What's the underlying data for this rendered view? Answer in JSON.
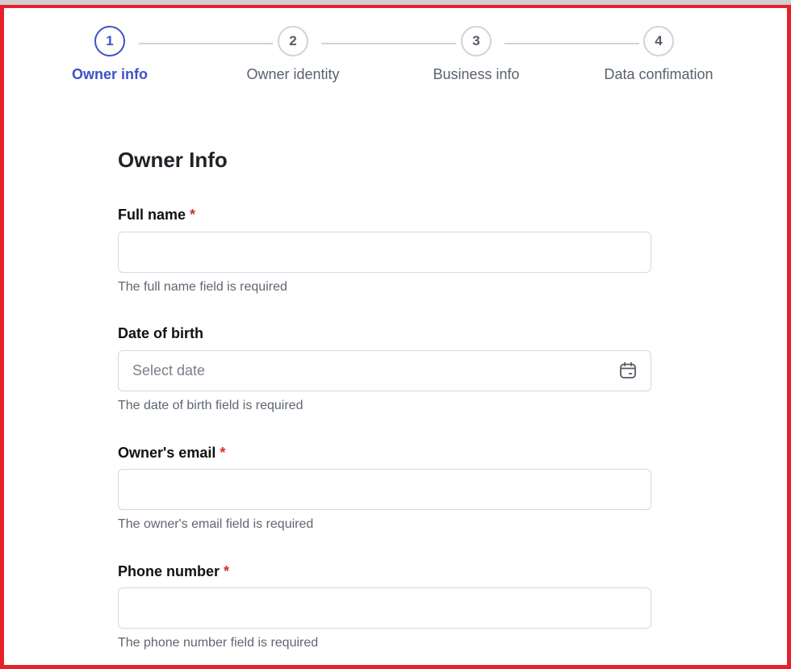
{
  "stepper": {
    "steps": [
      {
        "number": "1",
        "label": "Owner info"
      },
      {
        "number": "2",
        "label": "Owner identity"
      },
      {
        "number": "3",
        "label": "Business info"
      },
      {
        "number": "4",
        "label": "Data confimation"
      }
    ],
    "active_step": 1
  },
  "form": {
    "title": "Owner Info",
    "fields": {
      "full_name": {
        "label": "Full name",
        "required_mark": "*",
        "value": "",
        "helper": "The full name field is required"
      },
      "date_of_birth": {
        "label": "Date of birth",
        "placeholder": "Select date",
        "icon": "calendar-icon",
        "helper": "The date of birth field is required"
      },
      "email": {
        "label": "Owner's email",
        "required_mark": "*",
        "value": "",
        "helper": "The owner's email field is required"
      },
      "phone": {
        "label": "Phone number",
        "required_mark": "*",
        "value": "",
        "helper": "The phone number field is required"
      }
    }
  },
  "colors": {
    "accent": "#3f51c9",
    "required": "#d32f2f",
    "frame_border": "#e8202a"
  }
}
